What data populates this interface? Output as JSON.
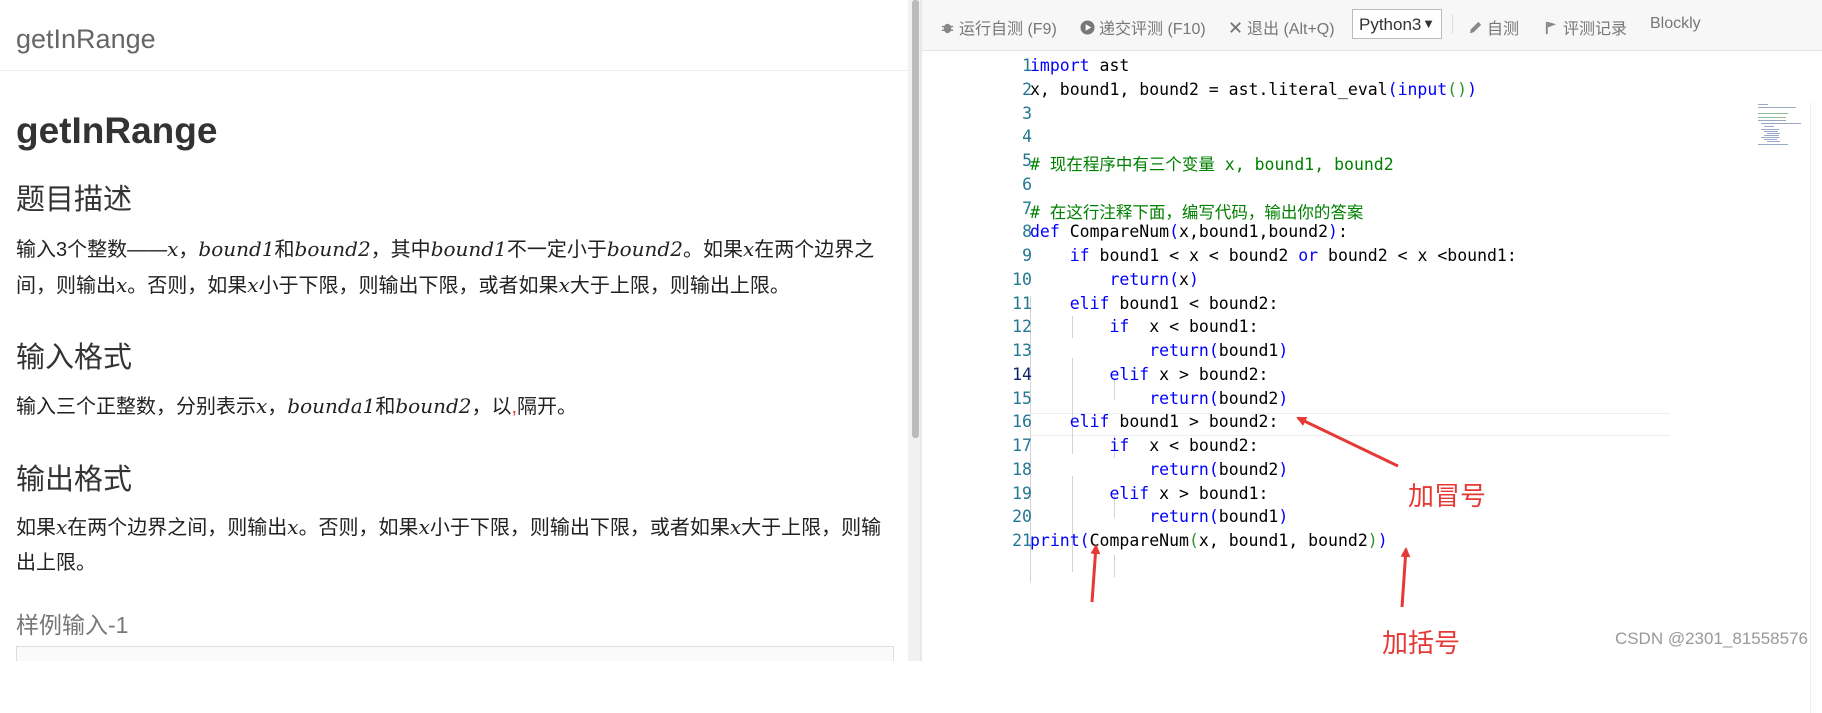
{
  "problem": {
    "view_title": "getInRange",
    "title": "getInRange",
    "sections": {
      "description_heading": "题目描述",
      "description": {
        "p1": "输入3个整数——",
        "v1": "x",
        "p2": "，",
        "v2": "bound1",
        "p3": "和",
        "v3": "bound2",
        "p4": "，其中",
        "v4": "bound1",
        "p5": "不一定小于",
        "v5": "bound2",
        "p6": "。如果",
        "v6": "x",
        "p7": "在两个边界之间，则输出",
        "v7": "x",
        "p8": "。否则，如果",
        "v8": "x",
        "p9": "小于下限，则输出下限，或者如果",
        "v9": "x",
        "p10": "大于上限，则输出上限。"
      },
      "input_heading": "输入格式",
      "input": {
        "p1": "输入三个正整数，分别表示",
        "v1": "x",
        "p2": "，",
        "v2": "bounda1",
        "p3": "和",
        "v3": "bound2",
        "p4": "，以",
        "p5": ",",
        "p6": "隔开。"
      },
      "output_heading": "输出格式",
      "output": {
        "p1": "如果",
        "v1": "x",
        "p2": "在两个边界之间，则输出",
        "v2": "x",
        "p3": "。否则，如果",
        "v3": "x",
        "p4": "小于下限，则输出下限，或者如果",
        "v4": "x",
        "p5": "大于上限，则输出上限。"
      },
      "sample_input_heading": "样例输入-1"
    }
  },
  "toolbar": {
    "run_self_test": "运行自测 (F9)",
    "submit": "递交评测 (F10)",
    "exit": "退出 (Alt+Q)",
    "language": "Python3",
    "self_test": "自测",
    "records": "评测记录",
    "blockly": "Blockly"
  },
  "editor": {
    "active_line": 14,
    "line_numbers": [
      "1",
      "2",
      "3",
      "4",
      "5",
      "6",
      "7",
      "8",
      "9",
      "10",
      "11",
      "12",
      "13",
      "14",
      "15",
      "16",
      "17",
      "18",
      "19",
      "20",
      "21"
    ],
    "lines": [
      "import ast",
      "x, bound1, bound2 = ast.literal_eval(input())",
      "",
      "",
      "# 现在程序中有三个变量 x, bound1, bound2",
      "",
      "# 在这行注释下面，编写代码，输出你的答案",
      "def CompareNum(x,bound1,bound2):",
      "    if bound1 < x < bound2 or bound2 < x <bound1:",
      "        return(x)",
      "    elif bound1 < bound2:",
      "        if  x < bound1:",
      "            return(bound1)",
      "        elif x > bound2:",
      "            return(bound2)",
      "    elif bound1 > bound2:",
      "        if  x < bound2:",
      "            return(bound2)",
      "        elif x > bound1:",
      "            return(bound1)",
      "print(CompareNum(x, bound1, bound2))"
    ]
  },
  "annotations": {
    "colon": "加冒号",
    "paren": "加括号"
  },
  "watermark": "CSDN @2301_81558576",
  "colors": {
    "annotation": "#e53935",
    "keyword": "#0000ff",
    "comment": "#008000",
    "line_number": "#237893"
  }
}
